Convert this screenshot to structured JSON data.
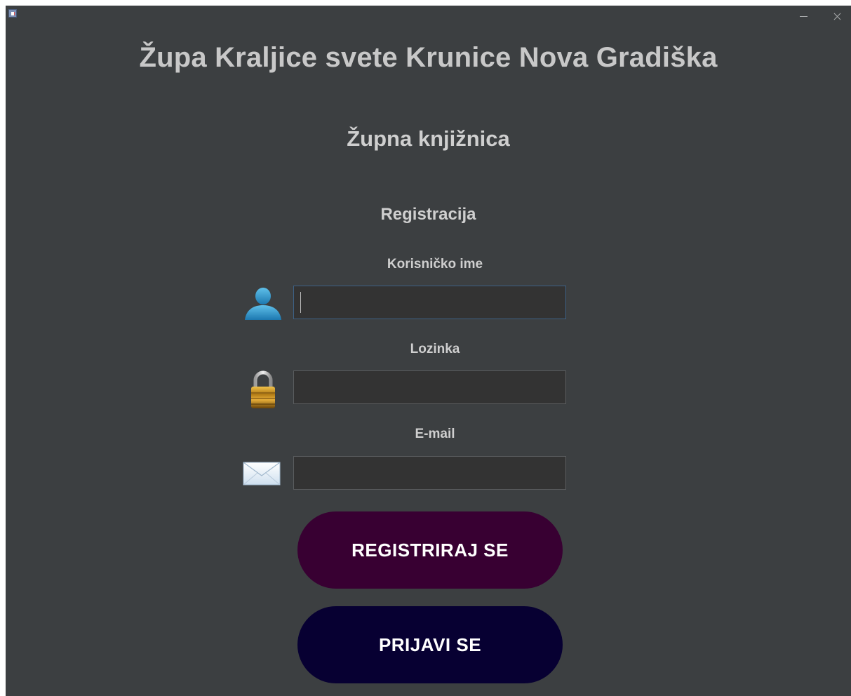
{
  "window": {
    "controls": {
      "minimize_icon": "minimize-icon",
      "close_icon": "close-icon"
    }
  },
  "header": {
    "title": "Župa Kraljice svete Krunice Nova Gradiška",
    "subtitle": "Župna knjižnica"
  },
  "form": {
    "heading": "Registracija",
    "username": {
      "label": "Korisničko ime",
      "value": "",
      "icon": "user-icon",
      "focused": true
    },
    "password": {
      "label": "Lozinka",
      "value": "",
      "icon": "lock-icon"
    },
    "email": {
      "label": "E-mail",
      "value": "",
      "icon": "envelope-icon"
    }
  },
  "buttons": {
    "register_label": "REGISTRIRAJ SE",
    "login_label": "PRIJAVI SE"
  },
  "colors": {
    "window_bg": "#3c3f41",
    "field_bg": "#333333",
    "focus_border": "#3d6185",
    "register_bg": "#380032",
    "login_bg": "#070032",
    "text": "#cfcfcf"
  }
}
